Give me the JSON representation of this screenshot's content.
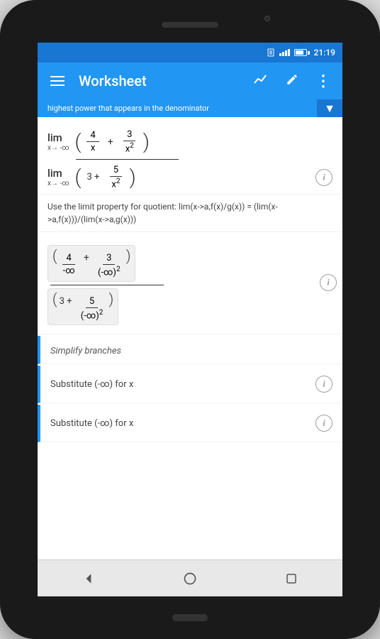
{
  "status": {
    "time": "21:19"
  },
  "appbar": {
    "title": "Worksheet",
    "menu_label": "menu",
    "chart_label": "chart",
    "edit_label": "edit",
    "more_label": "more"
  },
  "scroll_hint": {
    "text": "highest power that appears in the denominator"
  },
  "sections": [
    {
      "id": "lim-fraction",
      "type": "math",
      "has_info": false,
      "description": "lim fraction expression top"
    },
    {
      "id": "lim-denominator",
      "type": "math",
      "has_info": true,
      "description": "lim denominator expression"
    },
    {
      "id": "property-text",
      "type": "text",
      "content": "Use the limit property for quotient:  lim(x->a,f(x)/g(x)) = (lim(x->a,f(x)))/(lim(x->a,g(x)))"
    },
    {
      "id": "eval-fraction",
      "type": "math",
      "has_info": true,
      "description": "evaluated fraction at -infinity"
    },
    {
      "id": "simplify",
      "type": "label",
      "content": "Simplify  branches"
    },
    {
      "id": "substitute-1",
      "type": "substitute",
      "content": "Substitute (-∞)  for  x",
      "has_info": true
    },
    {
      "id": "substitute-2",
      "type": "substitute",
      "content": "Substitute (-∞)  for  x",
      "has_info": true
    }
  ],
  "nav": {
    "back": "◁",
    "home": "○",
    "recent": "□"
  }
}
